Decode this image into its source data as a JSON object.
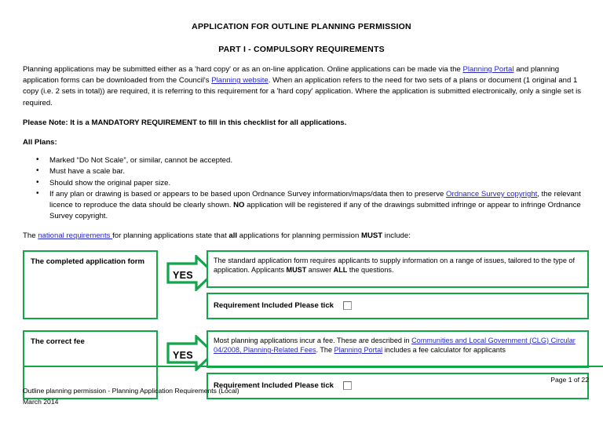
{
  "document": {
    "title": "APPLICATION FOR OUTLINE PLANNING PERMISSION",
    "subtitle": "PART I - COMPULSORY REQUIREMENTS"
  },
  "intro": {
    "p1_a": "Planning applications may be submitted either as a 'hard copy' or as an on-line application. Online applications can be made via the ",
    "link_planning_portal": "Planning Portal",
    "p1_b": " and planning application forms can be downloaded from the Council's ",
    "link_planning_website": "Planning website",
    "p1_c": ". When an application refers to the need for two sets of a plans or document (1 original and 1 copy (i.e. 2 sets in total)) are required, it is referring to this requirement for a 'hard copy' application.  Where the application is submitted electronically, only a single set is required.",
    "note_a": "Please Note: It is a ",
    "note_bold": "MANDATORY REQUIREMENT",
    "note_b": " to fill in this checklist for all applications."
  },
  "all_plans": {
    "heading": "All Plans:",
    "bullets": [
      "Marked “Do Not Scale”, or similar, cannot be accepted.",
      "Must have a scale bar.",
      "Should show the original paper size."
    ],
    "bullet4_a": "If any plan or drawing is based or appears to be based upon Ordnance Survey information/maps/data then to preserve ",
    "bullet4_link": "Ordnance Survey copyright",
    "bullet4_b": ", the relevant licence to reproduce the data should be clearly shown.  ",
    "bullet4_bold": "NO",
    "bullet4_c": " application will be registered if any of the drawings submitted infringe or appear to infringe Ordnance Survey copyright."
  },
  "national": {
    "a": "The ",
    "link": "national requirements ",
    "b": "for planning applications state that ",
    "bold1": "all",
    "c": " applications for planning permission ",
    "bold2": "MUST",
    "d": " include:"
  },
  "requirements": [
    {
      "title": "The completed application form",
      "arrow_label": "YES",
      "description_a": "The standard application form requires applicants to supply information on a range of issues, tailored to the type of application. Applicants ",
      "description_bold1": "MUST",
      "description_b": " answer ",
      "description_bold2": "ALL",
      "description_c": " the questions.",
      "tick_label": "Requirement Included Please tick"
    },
    {
      "title": "The correct fee",
      "arrow_label": "YES",
      "description_a": "Most planning applications incur a fee. These are described in ",
      "link1": "Communities and Local Government (CLG) Circular 04/2008, Planning-Related Fees",
      "description_b": ". The ",
      "link2": "Planning Portal",
      "description_c": " includes a fee calculator for applicants",
      "tick_label": "Requirement Included Please tick"
    }
  ],
  "footer": {
    "page_number": "Page 1 of 22",
    "line1": "Outline planning permission - Planning Application Requirements (Local)",
    "line2": "March 2014"
  },
  "colors": {
    "green": "#12A54A",
    "link": "#2727C4"
  }
}
